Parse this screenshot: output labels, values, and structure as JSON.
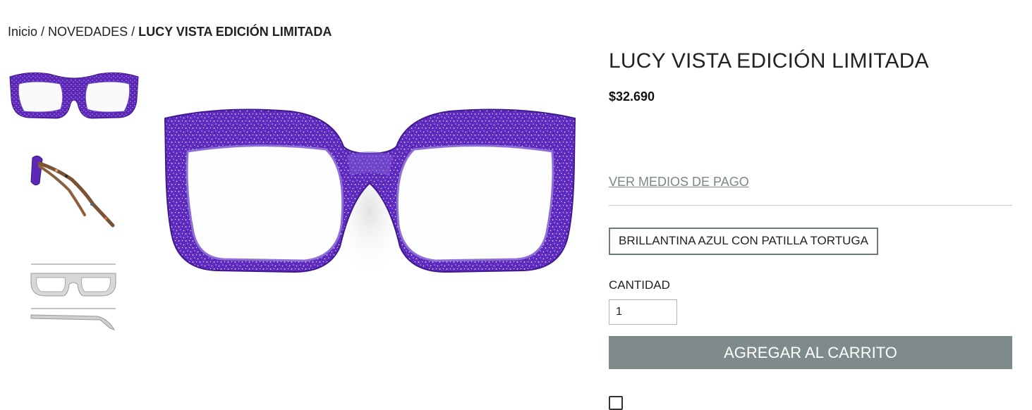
{
  "breadcrumb": {
    "home": "Inicio",
    "separator": "/",
    "category": "NOVEDADES",
    "current": "LUCY VISTA EDICIÓN LIMITADA"
  },
  "product": {
    "title": "LUCY VISTA EDICIÓN LIMITADA",
    "price": "$32.690",
    "payment_link": "VER MEDIOS DE PAGO",
    "variant": "BRILLANTINA AZUL CON PATILLA TORTUGA",
    "quantity_label": "CANTIDAD",
    "quantity_value": "1",
    "add_to_cart": "AGREGAR AL CARRITO"
  },
  "gallery": {
    "thumbnails": [
      "front-view",
      "side-view",
      "dimensions-diagram"
    ],
    "main": "front-view"
  },
  "colors": {
    "frame_purple": "#6a2fc4",
    "button": "#7e8b8a",
    "link": "#7b8786"
  }
}
